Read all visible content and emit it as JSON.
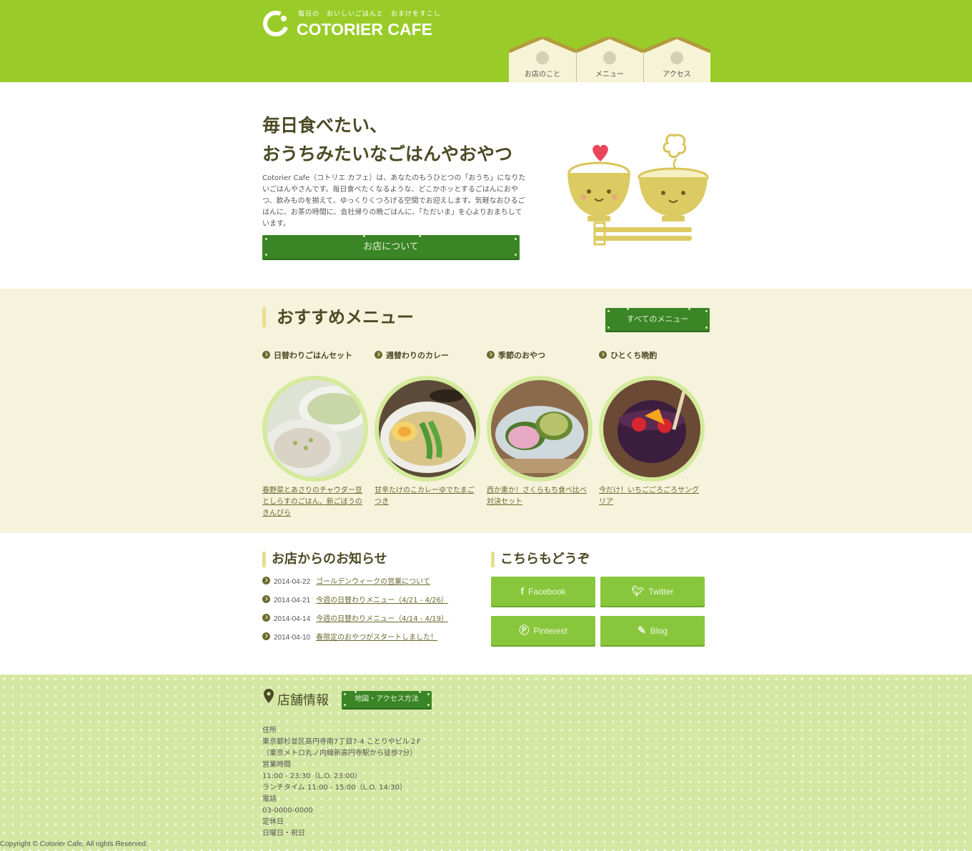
{
  "header": {
    "tagline": "毎日の　おいしいごはんと　おまけをすこし",
    "site_name": "COTORIER CAFE",
    "nav": [
      {
        "label": "お店のこと"
      },
      {
        "label": "メニュー"
      },
      {
        "label": "アクセス"
      }
    ]
  },
  "hero": {
    "title_line1": "毎日食べたい、",
    "title_line2": "おうちみたいなごはんやおやつ",
    "text": "Cotorier Cafe（コトリエ カフェ）は、あなたのもうひとつの「おうち」になりたいごはんやさんです。毎日食べたくなるような、どこかホッとするごはんにおやつ、飲みものを揃えて、ゆっくりくつろげる空間でお迎えします。気軽なおひるごはんに、お茶の時間に、会社帰りの晩ごはんに、「ただいま」を心よりおまちしています。",
    "button": "お店について"
  },
  "menu": {
    "heading": "おすすめメニュー",
    "all_button": "すべてのメニュー",
    "items": [
      {
        "category": "日替わりごはんセット",
        "link": "春野菜とあさりのチャウダー豆としらすのごはん、新ごぼうのきんぴら"
      },
      {
        "category": "週替わりのカレー",
        "link": "甘辛たけのこカレーゆでたまごつき"
      },
      {
        "category": "季節のおやつ",
        "link": "西か東か！さくらもち食べ比べ対決セット"
      },
      {
        "category": "ひとくち晩酌",
        "link": "今だけ！いちごごろごろサングリア"
      }
    ]
  },
  "news": {
    "heading": "お店からのお知らせ",
    "items": [
      {
        "date": "2014-04-22",
        "title": "ゴールデンウィークの営業について"
      },
      {
        "date": "2014-04-21",
        "title": "今週の日替わりメニュー（4/21 - 4/26）"
      },
      {
        "date": "2014-04-14",
        "title": "今週の日替わりメニュー（4/14 - 4/19）"
      },
      {
        "date": "2014-04-10",
        "title": "春限定のおやつがスタートしました！"
      }
    ]
  },
  "social": {
    "heading": "こちらもどうぞ",
    "buttons": [
      {
        "label": "Facebook",
        "icon": "facebook-icon"
      },
      {
        "label": "Twitter",
        "icon": "twitter-icon"
      },
      {
        "label": "Pinterest",
        "icon": "pinterest-icon"
      },
      {
        "label": "Blog",
        "icon": "pencil-icon"
      }
    ]
  },
  "shop": {
    "heading": "店舗情報",
    "map_button": "地図・アクセス方法",
    "lines": [
      "住所",
      "東京都杉並区高円寺南7丁目7-4 ことりやビル２F",
      "（東京メトロ丸ノ内線新高円寺駅から徒歩7分）",
      "営業時間",
      "11:00 - 23:30（L.O. 23:00）",
      "ランチタイム 11:00 - 15:00（L.O. 14:30）",
      "電話",
      "03-0000-0000",
      "定休日",
      "日曜日・祝日"
    ]
  },
  "copyright": "Copyright © Cotorier Cafe, All rights Reserved.",
  "colors": {
    "header_green": "#99cc29",
    "button_green": "#3a8526",
    "social_green": "#88c73c",
    "menu_bg": "#f5f3dc",
    "heading_brown": "#4b4a24"
  }
}
